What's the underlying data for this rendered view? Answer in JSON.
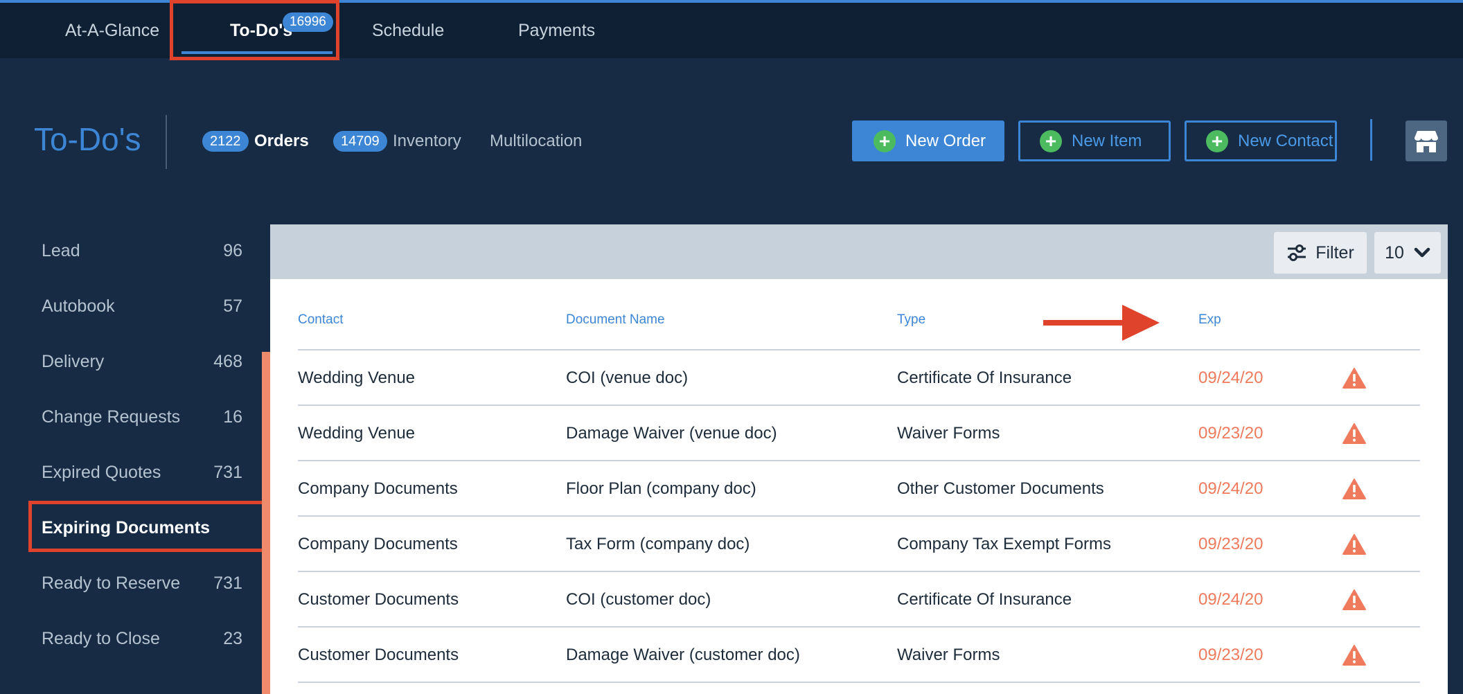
{
  "top_nav": {
    "tabs": [
      {
        "label": "At-A-Glance"
      },
      {
        "label": "To-Do's",
        "badge": "16996",
        "active": true
      },
      {
        "label": "Schedule"
      },
      {
        "label": "Payments"
      }
    ]
  },
  "header": {
    "title": "To-Do's",
    "subtabs": [
      {
        "label": "Orders",
        "count": "2122",
        "active": true
      },
      {
        "label": "Inventory",
        "count": "14709"
      },
      {
        "label": "Multilocation"
      }
    ],
    "actions": {
      "new_order": "New Order",
      "new_item": "New Item",
      "new_contact": "New Contact"
    }
  },
  "sidebar": {
    "items": [
      {
        "label": "Lead",
        "count": "96"
      },
      {
        "label": "Autobook",
        "count": "57"
      },
      {
        "label": "Delivery",
        "count": "468"
      },
      {
        "label": "Change Requests",
        "count": "16"
      },
      {
        "label": "Expired Quotes",
        "count": "731"
      },
      {
        "label": "Expiring Documents",
        "count": "",
        "active": true
      },
      {
        "label": "Ready to Reserve",
        "count": "731"
      },
      {
        "label": "Ready to Close",
        "count": "23"
      }
    ]
  },
  "toolbar": {
    "filter_label": "Filter",
    "page_size": "10"
  },
  "table": {
    "columns": [
      "Contact",
      "Document Name",
      "Type",
      "Exp"
    ],
    "rows": [
      {
        "contact": "Wedding Venue",
        "document": "COI (venue doc)",
        "type": "Certificate Of Insurance",
        "exp": "09/24/20"
      },
      {
        "contact": "Wedding Venue",
        "document": "Damage Waiver (venue doc)",
        "type": "Waiver Forms",
        "exp": "09/23/20"
      },
      {
        "contact": "Company Documents",
        "document": "Floor Plan (company doc)",
        "type": "Other Customer Documents",
        "exp": "09/24/20"
      },
      {
        "contact": "Company Documents",
        "document": "Tax Form (company doc)",
        "type": "Company Tax Exempt Forms",
        "exp": "09/23/20"
      },
      {
        "contact": "Customer Documents",
        "document": "COI (customer doc)",
        "type": "Certificate Of Insurance",
        "exp": "09/24/20"
      },
      {
        "contact": "Customer Documents",
        "document": "Damage Waiver (customer doc)",
        "type": "Waiver Forms",
        "exp": "09/23/20"
      }
    ]
  },
  "colors": {
    "accent": "#3d86d6",
    "nav_bg": "#0f2035",
    "page_bg": "#172b45",
    "highlight": "#e0432b",
    "expiry": "#ef7a5c",
    "add": "#4cbb5f"
  },
  "icons": {
    "add": "plus-circle-icon",
    "store": "storefront-icon",
    "filter": "sliders-icon",
    "dropdown": "chevron-down-icon",
    "warning": "warning-triangle-icon",
    "annotation": "arrow-right-icon"
  }
}
